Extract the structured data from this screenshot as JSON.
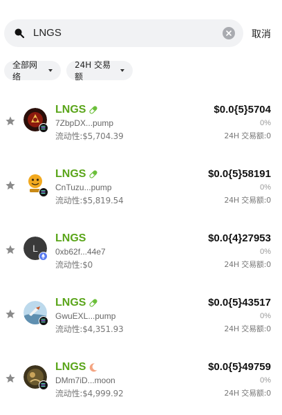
{
  "search": {
    "query": "LNGS",
    "cancel_label": "取消"
  },
  "filters": {
    "network_label": "全部网络",
    "volume_label": "24H 交易额"
  },
  "tokens": [
    {
      "name": "LNGS",
      "address": "7ZbpDX...pump",
      "liquidity": "流动性:$5,704.39",
      "price": "$0.0{5}5704",
      "change": "0%",
      "volume": "24H 交易额:0",
      "avatar_color": "#8b1a0e",
      "chain": "solana",
      "tag_icon": "pill-icon"
    },
    {
      "name": "LNGS",
      "address": "CnTuzu...pump",
      "liquidity": "流动性:$5,819.54",
      "price": "$0.0{5}58191",
      "change": "0%",
      "volume": "24H 交易额:0",
      "avatar_color": "#f2a91f",
      "chain": "solana",
      "tag_icon": "pill-icon"
    },
    {
      "name": "LNGS",
      "address": "0xb62f...44e7",
      "liquidity": "流动性:$0",
      "price": "$0.0{4}27953",
      "change": "0%",
      "volume": "24H 交易额:0",
      "avatar_color": "#3a3a3a",
      "avatar_letter": "L",
      "chain": "ethereum",
      "tag_icon": ""
    },
    {
      "name": "LNGS",
      "address": "GwuEXL...pump",
      "liquidity": "流动性:$4,351.93",
      "price": "$0.0{5}43517",
      "change": "0%",
      "volume": "24H 交易额:0",
      "avatar_color": "#5f8fb0",
      "chain": "solana",
      "tag_icon": "pill-icon"
    },
    {
      "name": "LNGS",
      "address": "DMm7iD...moon",
      "liquidity": "流动性:$4,999.92",
      "price": "$0.0{5}49759",
      "change": "0%",
      "volume": "24H 交易额:0",
      "avatar_color": "#6b5a2e",
      "chain": "solana",
      "tag_icon": "moon-icon"
    }
  ],
  "colors": {
    "accent_green": "#5aa51a",
    "pill_green": "#6bbf3a",
    "moon_orange": "#f4a582",
    "chip_bg": "#f1f2f4"
  }
}
